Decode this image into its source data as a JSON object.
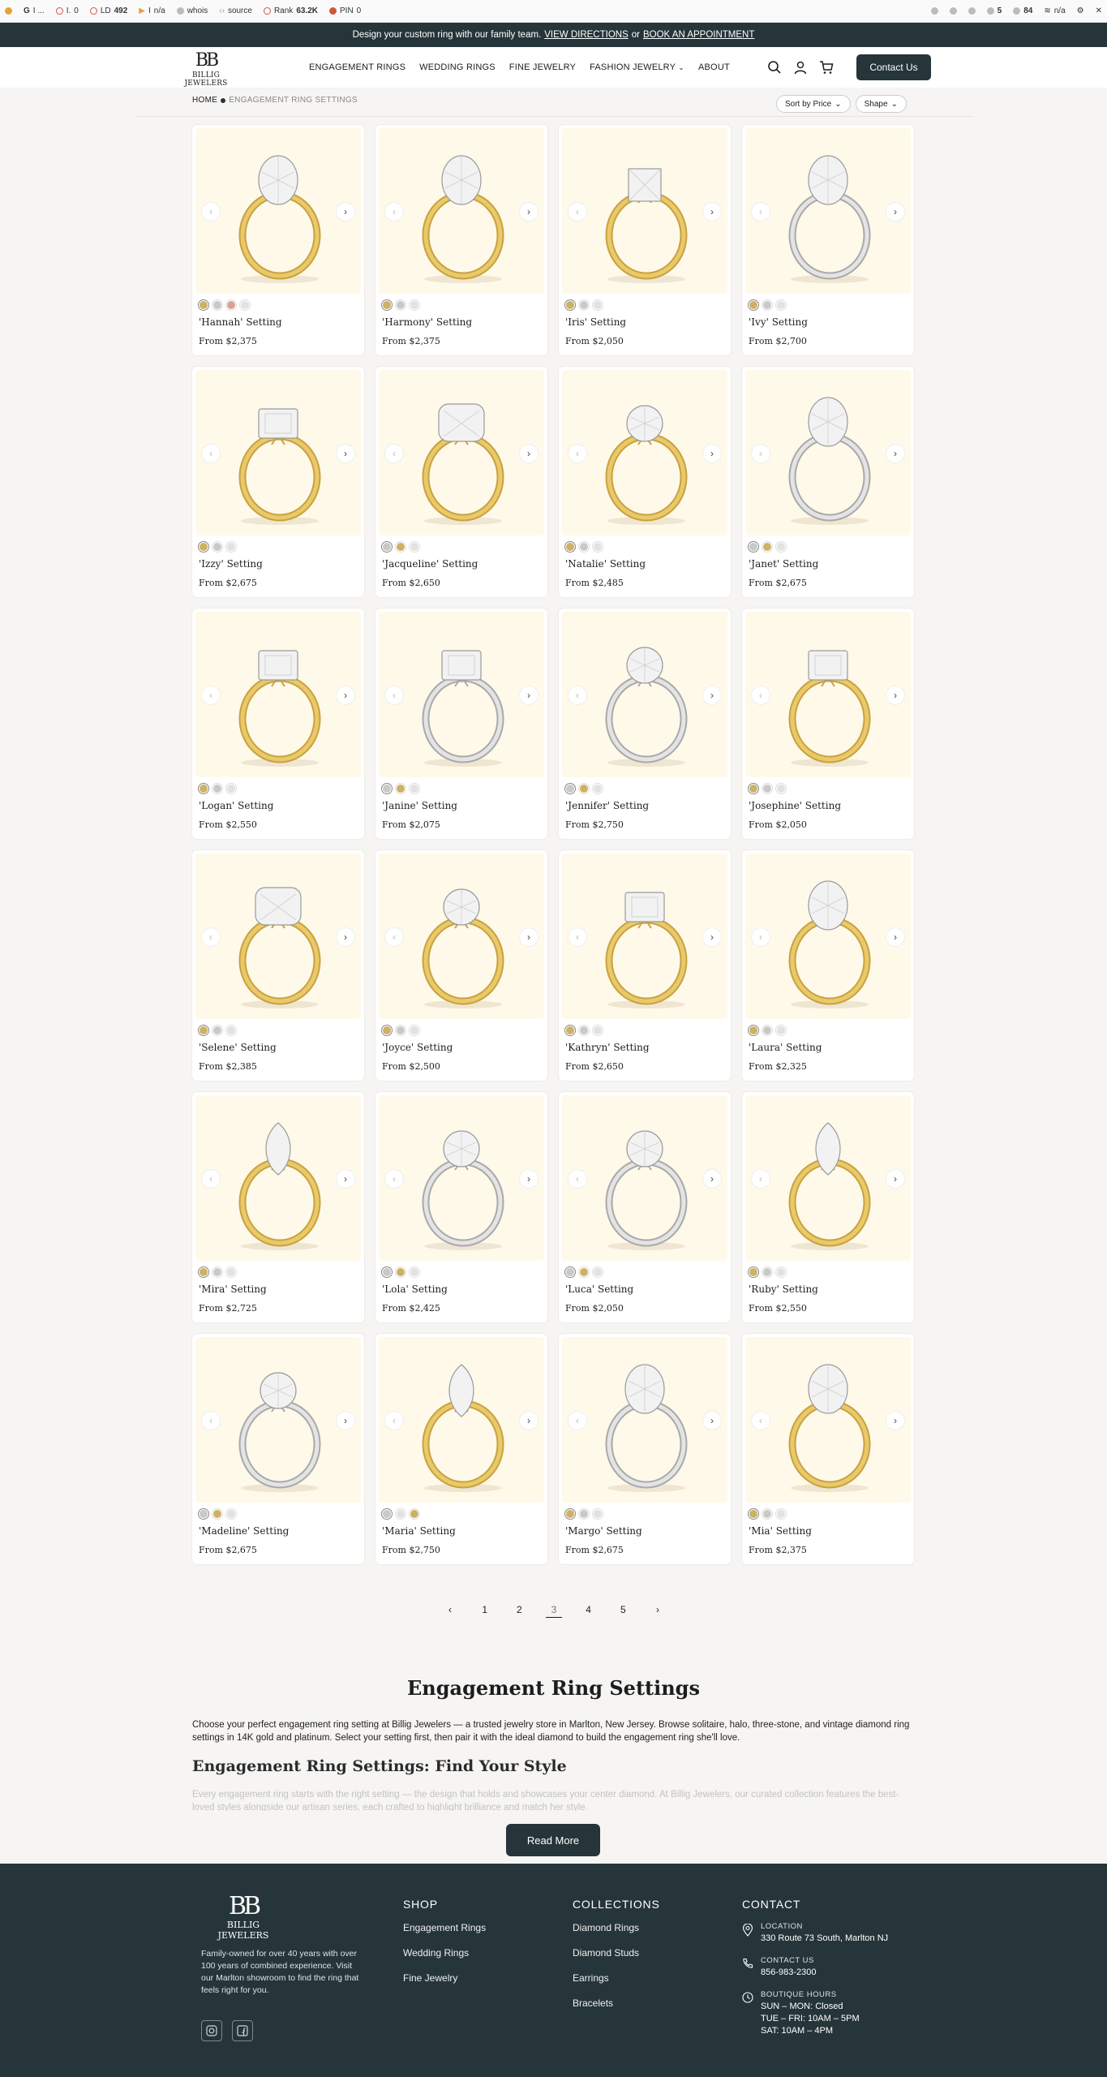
{
  "seo_toolbar": {
    "items": [
      {
        "label": "G"
      },
      {
        "label": "I ..."
      },
      {
        "label": "I.",
        "value": "0"
      },
      {
        "label": "LD",
        "value": "492"
      },
      {
        "label": "I",
        "value": "n/a"
      },
      {
        "label": "whois"
      },
      {
        "label": "source"
      },
      {
        "label": "Rank",
        "value": "63.2K"
      },
      {
        "label": "PIN",
        "value": "0"
      }
    ],
    "right": [
      {
        "value": "5"
      },
      {
        "value": "84"
      },
      {
        "value": "n/a"
      }
    ]
  },
  "promo": {
    "text": "Design your custom ring with our family team.",
    "link1": "VIEW DIRECTIONS",
    "or": "or",
    "link2": "BOOK AN APPOINTMENT"
  },
  "header": {
    "logo_mark": "BB",
    "logo_text": "BILLIG JEWELERS",
    "nav": [
      "ENGAGEMENT RINGS",
      "WEDDING RINGS",
      "FINE JEWELRY",
      "FASHION JEWELRY",
      "ABOUT"
    ],
    "contact": "Contact Us"
  },
  "breadcrumb": {
    "home": "HOME",
    "current": "ENGAGEMENT RING SETTINGS"
  },
  "filters": {
    "sort": "Sort by Price",
    "shape": "Shape"
  },
  "colors": {
    "yellow": "#cdb266",
    "white": "#c9c9c9",
    "platinum": "#e2e2e2",
    "rose": "#dba28f",
    "dark": "#253539",
    "card_bg": "#fff9ea"
  },
  "products": [
    {
      "name": "'Hannah' Setting",
      "price": "From $2,375",
      "swatches": [
        "yellow",
        "white",
        "rose",
        "platinum"
      ],
      "metal": "yellow",
      "stone": "oval"
    },
    {
      "name": "'Harmony' Setting",
      "price": "From $2,375",
      "swatches": [
        "yellow",
        "white",
        "platinum"
      ],
      "metal": "yellow",
      "stone": "oval"
    },
    {
      "name": "'Iris' Setting",
      "price": "From $2,050",
      "swatches": [
        "yellow",
        "white",
        "platinum"
      ],
      "metal": "yellow",
      "stone": "princess"
    },
    {
      "name": "'Ivy' Setting",
      "price": "From $2,700",
      "swatches": [
        "yellow",
        "white",
        "platinum"
      ],
      "metal": "white",
      "stone": "oval"
    },
    {
      "name": "'Izzy' Setting",
      "price": "From $2,675",
      "swatches": [
        "yellow",
        "white",
        "platinum"
      ],
      "metal": "yellow",
      "stone": "emerald"
    },
    {
      "name": "'Jacqueline' Setting",
      "price": "From $2,650",
      "swatches": [
        "white",
        "yellow",
        "platinum"
      ],
      "metal": "yellow",
      "stone": "cushion"
    },
    {
      "name": "'Natalie' Setting",
      "price": "From $2,485",
      "swatches": [
        "yellow",
        "white",
        "platinum"
      ],
      "metal": "yellow",
      "stone": "round"
    },
    {
      "name": "'Janet' Setting",
      "price": "From $2,675",
      "swatches": [
        "white",
        "yellow",
        "platinum"
      ],
      "metal": "white",
      "stone": "oval"
    },
    {
      "name": "'Logan' Setting",
      "price": "From $2,550",
      "swatches": [
        "yellow",
        "white",
        "platinum"
      ],
      "metal": "yellow",
      "stone": "emerald"
    },
    {
      "name": "'Janine' Setting",
      "price": "From $2,075",
      "swatches": [
        "white",
        "yellow",
        "platinum"
      ],
      "metal": "white",
      "stone": "emerald"
    },
    {
      "name": "'Jennifer' Setting",
      "price": "From $2,750",
      "swatches": [
        "white",
        "yellow",
        "platinum"
      ],
      "metal": "white",
      "stone": "round"
    },
    {
      "name": "'Josephine' Setting",
      "price": "From $2,050",
      "swatches": [
        "yellow",
        "white",
        "platinum"
      ],
      "metal": "yellow",
      "stone": "emerald"
    },
    {
      "name": "'Selene' Setting",
      "price": "From $2,385",
      "swatches": [
        "yellow",
        "white",
        "platinum"
      ],
      "metal": "yellow",
      "stone": "cushion"
    },
    {
      "name": "'Joyce' Setting",
      "price": "From $2,500",
      "swatches": [
        "yellow",
        "white",
        "platinum"
      ],
      "metal": "yellow",
      "stone": "round"
    },
    {
      "name": "'Kathryn' Setting",
      "price": "From $2,650",
      "swatches": [
        "yellow",
        "white",
        "platinum"
      ],
      "metal": "yellow",
      "stone": "emerald"
    },
    {
      "name": "'Laura' Setting",
      "price": "From $2,325",
      "swatches": [
        "yellow",
        "white",
        "platinum"
      ],
      "metal": "yellow",
      "stone": "oval"
    },
    {
      "name": "'Mira' Setting",
      "price": "From $2,725",
      "swatches": [
        "yellow",
        "white",
        "platinum"
      ],
      "metal": "yellow",
      "stone": "marquise"
    },
    {
      "name": "'Lola' Setting",
      "price": "From $2,425",
      "swatches": [
        "white",
        "yellow",
        "platinum"
      ],
      "metal": "white",
      "stone": "round"
    },
    {
      "name": "'Luca' Setting",
      "price": "From $2,050",
      "swatches": [
        "white",
        "yellow",
        "platinum"
      ],
      "metal": "white",
      "stone": "round"
    },
    {
      "name": "'Ruby' Setting",
      "price": "From $2,550",
      "swatches": [
        "yellow",
        "white",
        "platinum"
      ],
      "metal": "yellow",
      "stone": "marquise"
    },
    {
      "name": "'Madeline' Setting",
      "price": "From $2,675",
      "swatches": [
        "white",
        "yellow",
        "platinum"
      ],
      "metal": "white",
      "stone": "round"
    },
    {
      "name": "'Maria' Setting",
      "price": "From $2,750",
      "swatches": [
        "white",
        "platinum",
        "yellow"
      ],
      "metal": "yellow",
      "stone": "marquise"
    },
    {
      "name": "'Margo' Setting",
      "price": "From $2,675",
      "swatches": [
        "yellow",
        "white",
        "platinum"
      ],
      "metal": "white",
      "stone": "oval"
    },
    {
      "name": "'Mia' Setting",
      "price": "From $2,375",
      "swatches": [
        "yellow",
        "white",
        "platinum"
      ],
      "metal": "yellow",
      "stone": "oval"
    }
  ],
  "pagination": {
    "prev": "‹",
    "pages": [
      "1",
      "2",
      "3",
      "4",
      "5"
    ],
    "current": "3",
    "next": "›"
  },
  "seo": {
    "title": "Engagement Ring Settings",
    "paragraph": "Choose your perfect engagement ring setting at Billig Jewelers — a trusted jewelry store in Marlton, New Jersey. Browse solitaire, halo, three-stone, and vintage diamond ring settings in 14K gold and platinum. Select your setting first, then pair it with the ideal diamond to build the engagement ring she'll love.",
    "subtitle": "Engagement Ring Settings: Find Your Style",
    "faded": "Every engagement ring starts with the right setting — the design that holds and showcases your center diamond. At Billig Jewelers, our curated collection features the best-loved styles alongside our artisan series, each crafted to highlight brilliance and match her style.",
    "read_more": "Read More"
  },
  "footer": {
    "logo_mark": "BB",
    "logo_text": "BILLIG JEWELERS",
    "about": "Family-owned for over 40 years with over 100 years of combined experience. Visit our Marlton showroom to find the ring that feels right for you.",
    "shop_title": "SHOP",
    "shop": [
      "Engagement Rings",
      "Wedding Rings",
      "Fine Jewelry"
    ],
    "collections_title": "COLLECTIONS",
    "collections": [
      "Diamond Rings",
      "Diamond Studs",
      "Earrings",
      "Bracelets"
    ],
    "contact_title": "CONTACT",
    "location_label": "LOCATION",
    "location": "330 Route 73 South, Marlton NJ",
    "contact_label": "CONTACT US",
    "phone": "856-983-2300",
    "hours_label": "BOUTIQUE HOURS",
    "hours": [
      "SUN – MON: Closed",
      "TUE – FRI: 10AM – 5PM",
      "SAT: 10AM – 4PM"
    ]
  }
}
